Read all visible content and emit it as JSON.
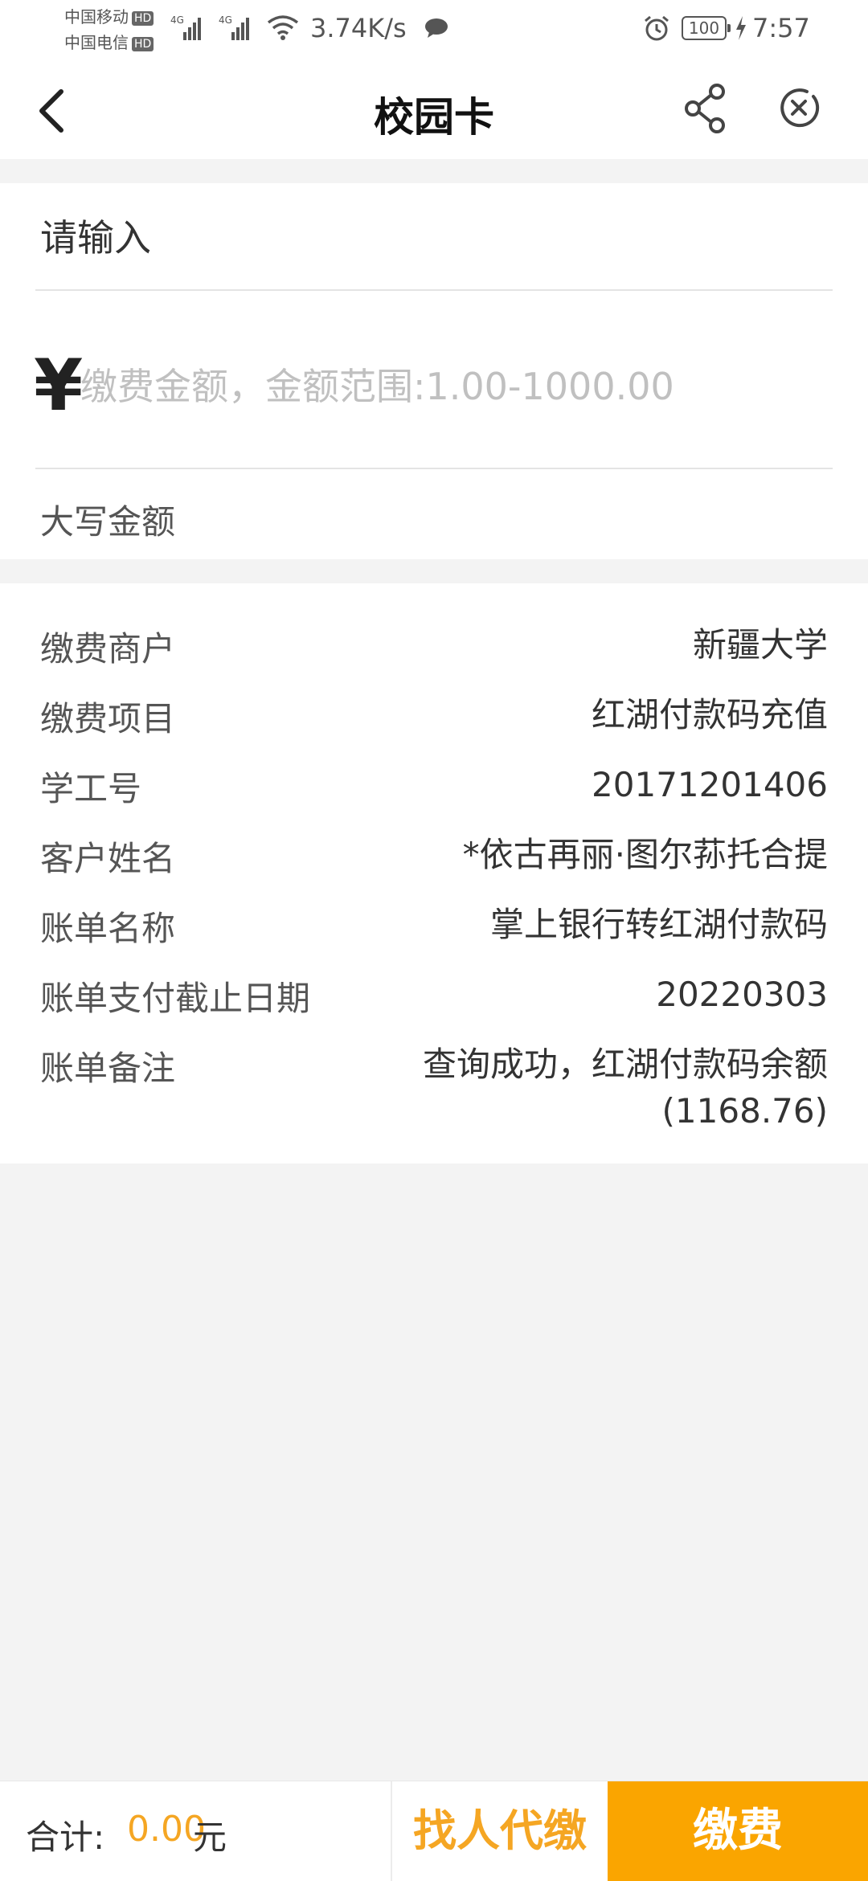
{
  "status_bar": {
    "carrier_1": "中国移动",
    "carrier_2": "中国电信",
    "hd_badge": "HD",
    "network_type": "4G",
    "net_speed": "3.74K/s",
    "battery": "100",
    "time": "7:57"
  },
  "header": {
    "title": "校园卡"
  },
  "payment_input": {
    "prompt": "请输入",
    "currency_symbol": "¥",
    "amount_value": "",
    "amount_placeholder": "缴费金额，金额范围:1.00-1000.00",
    "capital_label": "大写金额"
  },
  "details": {
    "rows": [
      {
        "label": "缴费商户",
        "value": "新疆大学"
      },
      {
        "label": "缴费项目",
        "value": "红湖付款码充值"
      },
      {
        "label": "学工号",
        "value": "20171201406"
      },
      {
        "label": "客户姓名",
        "value": "*依古再丽·图尔荪托合提"
      },
      {
        "label": "账单名称",
        "value": "掌上银行转红湖付款码"
      },
      {
        "label": "账单支付截止日期",
        "value": "20220303"
      },
      {
        "label": "账单备注",
        "value": "查询成功，红湖付款码余额",
        "value_2": "(1168.76)"
      }
    ]
  },
  "footer": {
    "total_label": "合计:",
    "total_amount": "0.00",
    "total_unit": "元",
    "proxy_pay_label": "找人代缴",
    "pay_label": "缴费"
  },
  "colors": {
    "accent": "#faa500",
    "accent_text": "#f5a623",
    "background": "#f3f3f3"
  }
}
